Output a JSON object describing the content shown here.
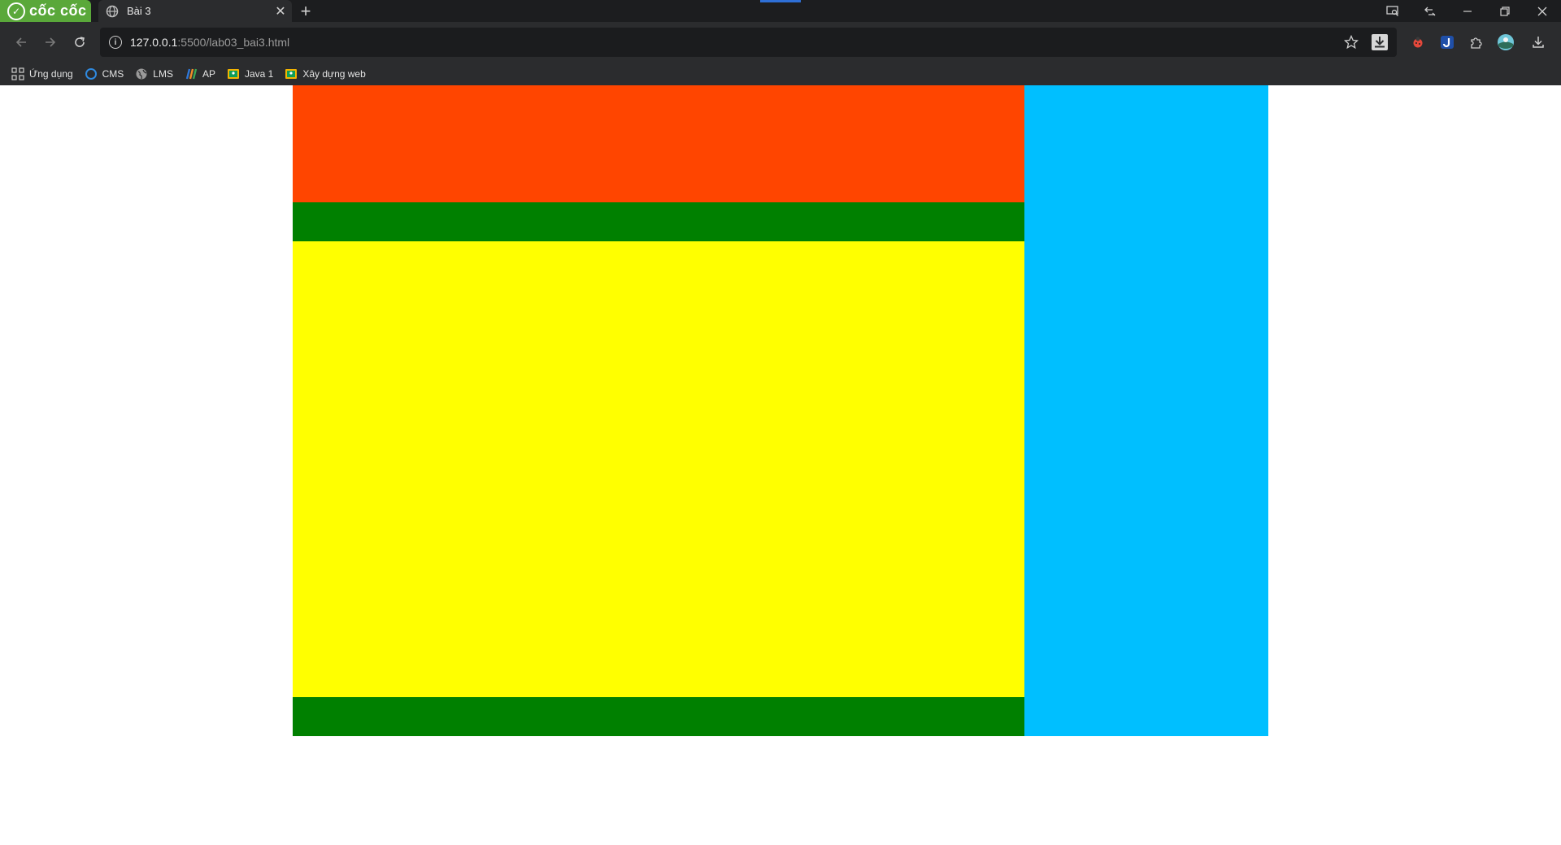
{
  "browser": {
    "brand_text": "cốc cốc",
    "tab_title": "Bài 3",
    "tab_close": "✕",
    "new_tab": "+",
    "url_host": "127.0.0.1",
    "url_rest": ":5500/lab03_bai3.html",
    "bookmarks": [
      {
        "label": "Ứng dụng",
        "icon": "apps-grid-icon"
      },
      {
        "label": "CMS",
        "icon": "cms-ring-icon"
      },
      {
        "label": "LMS",
        "icon": "globe-icon"
      },
      {
        "label": "AP",
        "icon": "fpt-icon"
      },
      {
        "label": "Java 1",
        "icon": "classroom-icon"
      },
      {
        "label": "Xây dựng web",
        "icon": "classroom-icon"
      }
    ]
  },
  "colors": {
    "header": "#ff4500",
    "nav": "#008000",
    "content": "#ffff00",
    "footer": "#008000",
    "sidebar": "#00bfff",
    "brand": "#5aa83a"
  }
}
